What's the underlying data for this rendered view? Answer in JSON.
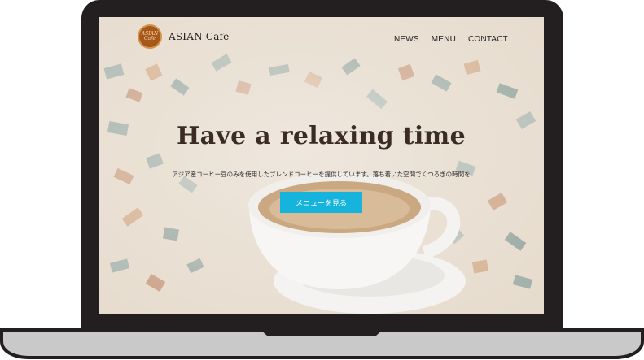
{
  "header": {
    "logo_text": "ASIAN Cafe",
    "brand": "ASIAN Cafe"
  },
  "nav": {
    "items": [
      {
        "label": "NEWS"
      },
      {
        "label": "MENU"
      },
      {
        "label": "CONTACT"
      }
    ]
  },
  "hero": {
    "title": "Have a relaxing time",
    "subtitle": "アジア産コーヒー豆のみを使用したブレンドコーヒーを提供しています。落ち着いた空間でくつろぎの時間を",
    "cta_label": "メニューを見る"
  },
  "colors": {
    "accent": "#16b4dc",
    "laptop": "#231f20",
    "logo": "#a6571c"
  }
}
